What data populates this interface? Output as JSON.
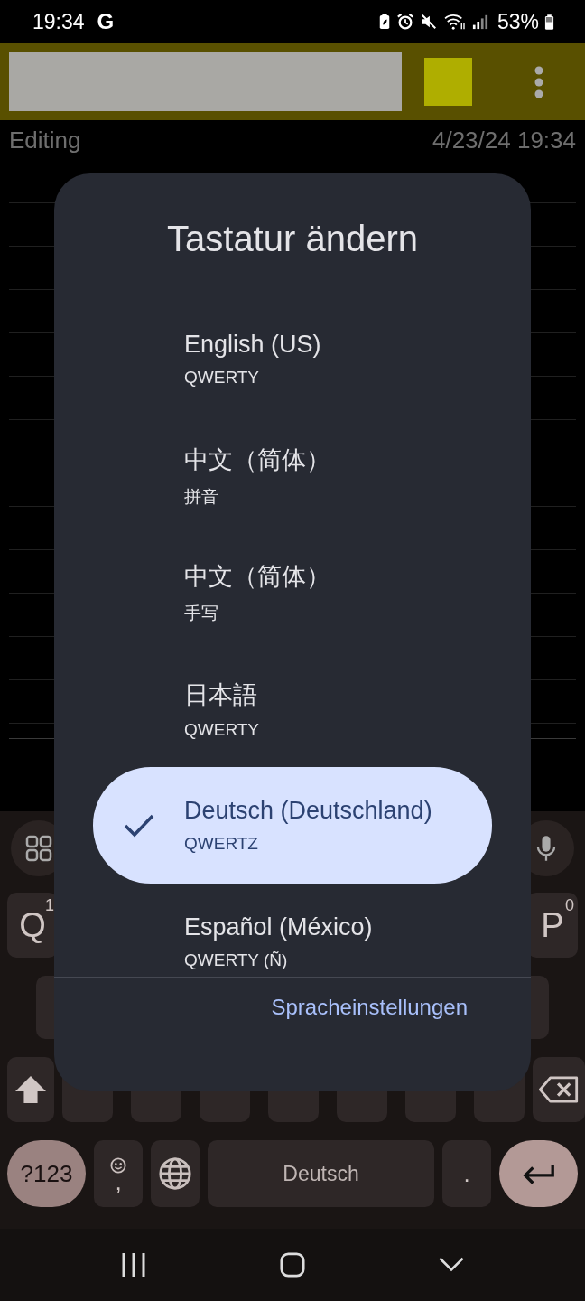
{
  "status_bar": {
    "time": "19:34",
    "notification": "G",
    "battery": "53%"
  },
  "note": {
    "status": "Editing",
    "timestamp": "4/23/24 19:34"
  },
  "dialog": {
    "title": "Tastatur ändern",
    "items": [
      {
        "name": "English (US)",
        "layout": "QWERTY",
        "selected": false
      },
      {
        "name": "中文（简体）",
        "layout": "拼音",
        "selected": false
      },
      {
        "name": "中文（简体）",
        "layout": "手写",
        "selected": false
      },
      {
        "name": "日本語",
        "layout": "QWERTY",
        "selected": false
      },
      {
        "name": "Deutsch (Deutschland)",
        "layout": "QWERTZ",
        "selected": true
      },
      {
        "name": "Español (México)",
        "layout": "QWERTY (Ñ)",
        "selected": false
      }
    ],
    "action": "Spracheinstellungen"
  },
  "keyboard": {
    "key_left": {
      "label": "Q",
      "hint": "1"
    },
    "key_right": {
      "label": "P",
      "hint": "0"
    },
    "symbols_key": "?123",
    "comma_key": ",",
    "space": "Deutsch",
    "period_key": "."
  }
}
